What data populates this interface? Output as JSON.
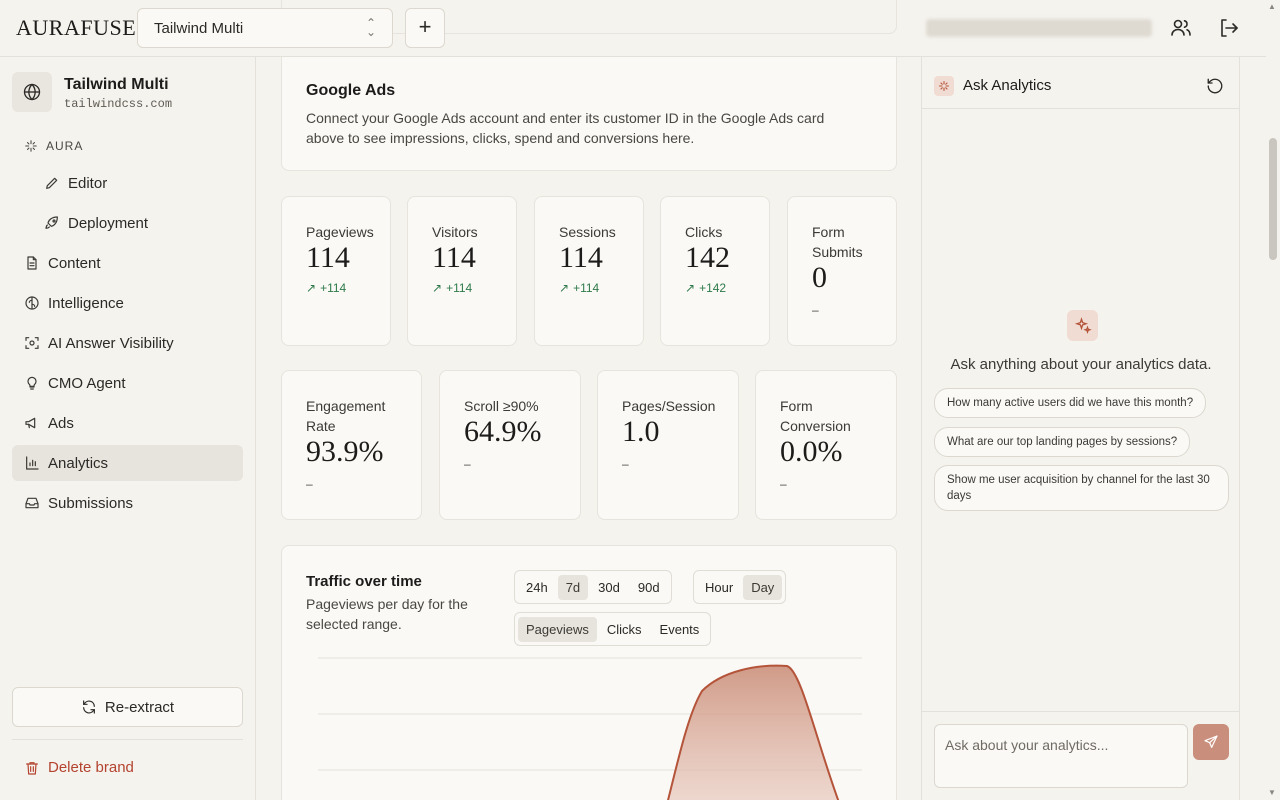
{
  "app": {
    "logo": "AURAFUSE",
    "brand_select": "Tailwind Multi",
    "add_symbol": "+"
  },
  "sidebar": {
    "brand_name": "Tailwind Multi",
    "brand_domain": "tailwindcss.com",
    "section_label": "AURA",
    "items": [
      {
        "label": "Editor",
        "icon": "pencil-icon"
      },
      {
        "label": "Deployment",
        "icon": "rocket-icon"
      },
      {
        "label": "Content",
        "icon": "document-icon"
      },
      {
        "label": "Intelligence",
        "icon": "brain-icon"
      },
      {
        "label": "AI Answer Visibility",
        "icon": "scan-eye-icon"
      },
      {
        "label": "CMO Agent",
        "icon": "lightbulb-icon"
      },
      {
        "label": "Ads",
        "icon": "megaphone-icon"
      },
      {
        "label": "Analytics",
        "icon": "bar-chart-icon",
        "active": true
      },
      {
        "label": "Submissions",
        "icon": "inbox-icon"
      }
    ],
    "reextract_label": "Re-extract",
    "delete_label": "Delete brand"
  },
  "google_ads": {
    "title": "Google Ads",
    "description": "Connect your Google Ads account and enter its customer ID in the Google Ads card above to see impressions, clicks, spend and conversions here."
  },
  "metrics_row1": [
    {
      "label": "Pageviews",
      "value": "114",
      "delta": "+114"
    },
    {
      "label": "Visitors",
      "value": "114",
      "delta": "+114"
    },
    {
      "label": "Sessions",
      "value": "114",
      "delta": "+114"
    },
    {
      "label": "Clicks",
      "value": "142",
      "delta": "+142"
    },
    {
      "label": "Form Submits",
      "value": "0",
      "delta": "–"
    }
  ],
  "metrics_row2": [
    {
      "label": "Engagement Rate",
      "value": "93.9%",
      "delta": "–"
    },
    {
      "label": "Scroll ≥90%",
      "value": "64.9%",
      "delta": "–"
    },
    {
      "label": "Pages/Session",
      "value": "1.0",
      "delta": "–"
    },
    {
      "label": "Form Conversion",
      "value": "0.0%",
      "delta": "–"
    }
  ],
  "traffic": {
    "title": "Traffic over time",
    "subtitle": "Pageviews per day for the selected range.",
    "ranges": [
      "24h",
      "7d",
      "30d",
      "90d"
    ],
    "range_selected": "7d",
    "granularity": [
      "Hour",
      "Day"
    ],
    "granularity_selected": "Day",
    "metrics": [
      "Pageviews",
      "Clicks",
      "Events"
    ],
    "metric_selected": "Pageviews"
  },
  "colors": {
    "accent": "#b4543a",
    "positive": "#2f7a4a",
    "danger": "#b4432f"
  },
  "analytics_panel": {
    "title": "Ask Analytics",
    "empty_text": "Ask anything about your analytics data.",
    "suggestions": [
      "How many active users did we have this month?",
      "What are our top landing pages by sessions?",
      "Show me user acquisition by channel for the last 30 days"
    ],
    "input_placeholder": "Ask about your analytics..."
  }
}
